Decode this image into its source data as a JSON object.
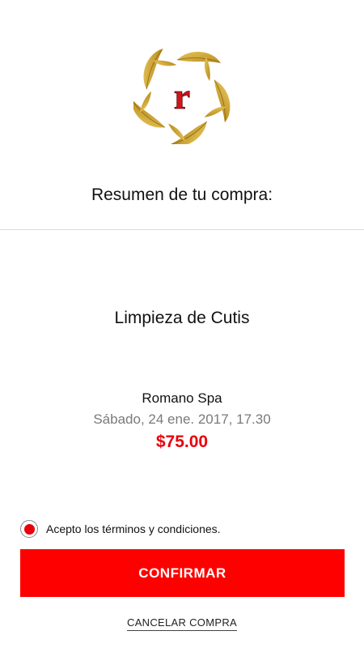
{
  "summary": {
    "title": "Resumen de tu compra:",
    "service": "Limpieza de Cutis",
    "vendor": "Romano Spa",
    "datetime": "Sábado, 24 ene. 2017, 17.30",
    "price": "$75.00"
  },
  "terms": {
    "label": "Acepto los términos y condiciones.",
    "accepted": true
  },
  "actions": {
    "confirm_label": "CONFIRMAR",
    "cancel_label": "CANCELAR COMPRA"
  },
  "logo": {
    "letter": "r",
    "icon": "gold-leaf-wreath-logo"
  },
  "colors": {
    "accent": "#ff0000",
    "price": "#e8000b",
    "logo_gold": "#c9a22e",
    "logo_letter": "#d4121d"
  }
}
